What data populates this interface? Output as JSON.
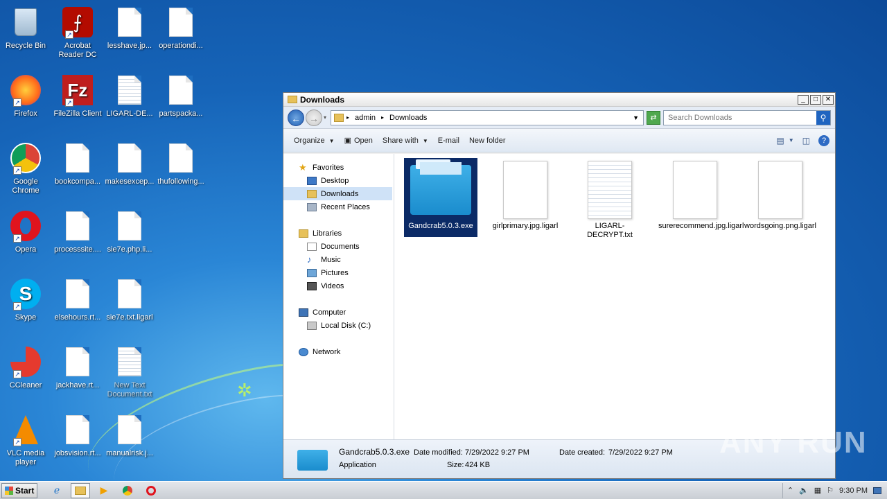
{
  "desktop": {
    "icons": [
      {
        "label": "Recycle Bin"
      },
      {
        "label": "Acrobat Reader DC"
      },
      {
        "label": "lesshave.jp..."
      },
      {
        "label": "operationdi..."
      },
      {
        "label": "Firefox"
      },
      {
        "label": "FileZilla Client"
      },
      {
        "label": "LIGARL-DE..."
      },
      {
        "label": "partspacka..."
      },
      {
        "label": "Google Chrome"
      },
      {
        "label": "bookcompa..."
      },
      {
        "label": "makesexcep..."
      },
      {
        "label": "thufollowing..."
      },
      {
        "label": "Opera"
      },
      {
        "label": "processsite...."
      },
      {
        "label": "sie7e.php.li..."
      },
      {
        "label": "Skype"
      },
      {
        "label": "elsehours.rt..."
      },
      {
        "label": "sie7e.txt.ligarl"
      },
      {
        "label": "CCleaner"
      },
      {
        "label": "jackhave.rt..."
      },
      {
        "label": "New Text Document.txt"
      },
      {
        "label": "VLC media player"
      },
      {
        "label": "jobsvision.rt..."
      },
      {
        "label": "manualrisk.j..."
      }
    ]
  },
  "window": {
    "title": "Downloads",
    "address": {
      "segments": [
        "admin",
        "Downloads"
      ]
    },
    "search_placeholder": "Search Downloads",
    "toolbar": {
      "organize": "Organize",
      "open": "Open",
      "share_with": "Share with",
      "email": "E-mail",
      "new_folder": "New folder"
    },
    "nav": {
      "favorites": "Favorites",
      "desktop": "Desktop",
      "downloads": "Downloads",
      "recent_places": "Recent Places",
      "libraries": "Libraries",
      "documents": "Documents",
      "music": "Music",
      "pictures": "Pictures",
      "videos": "Videos",
      "computer": "Computer",
      "local_disk": "Local Disk (C:)",
      "network": "Network"
    },
    "files": [
      {
        "name": "Gandcrab5.0.3.exe"
      },
      {
        "name": "girlprimary.jpg.ligarl"
      },
      {
        "name": "LIGARL-DECRYPT.txt"
      },
      {
        "name": "surerecommend.jpg.ligarl"
      },
      {
        "name": "wordsgoing.png.ligarl"
      }
    ],
    "details": {
      "name": "Gandcrab5.0.3.exe",
      "type": "Application",
      "date_modified_label": "Date modified:",
      "date_modified": "7/29/2022 9:27 PM",
      "date_created_label": "Date created:",
      "date_created": "7/29/2022 9:27 PM",
      "size_label": "Size:",
      "size": "424 KB"
    }
  },
  "taskbar": {
    "start": "Start",
    "clock": "9:30 PM"
  },
  "watermark": "ANY RUN"
}
